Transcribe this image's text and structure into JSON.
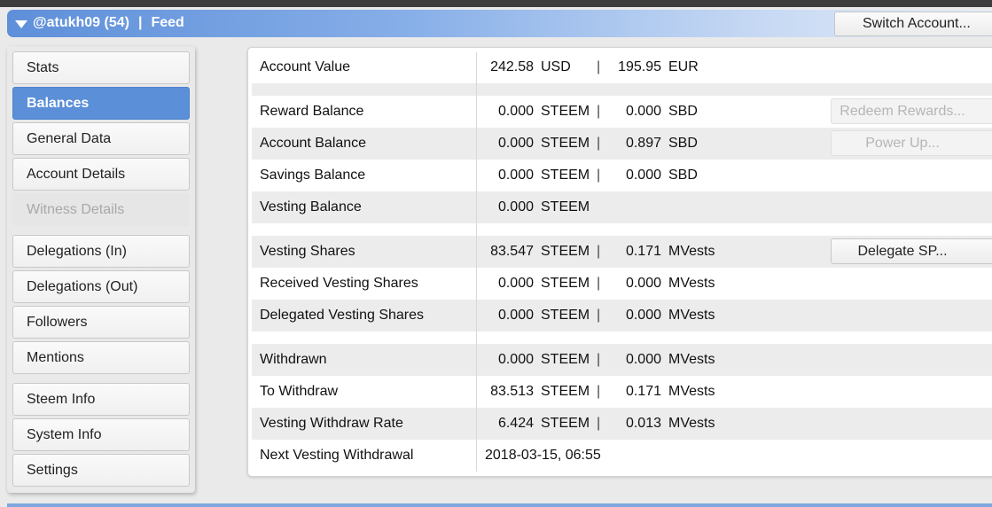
{
  "header": {
    "account": "@atukh09 (54)",
    "separator": "|",
    "section": "Feed",
    "switch_label": "Switch Account..."
  },
  "sidebar": {
    "items": [
      {
        "label": "Stats"
      },
      {
        "label": "Balances"
      },
      {
        "label": "General Data"
      },
      {
        "label": "Account Details"
      },
      {
        "label": "Witness Details"
      },
      {
        "label": "Delegations (In)"
      },
      {
        "label": "Delegations (Out)"
      },
      {
        "label": "Followers"
      },
      {
        "label": "Mentions"
      },
      {
        "label": "Steem Info"
      },
      {
        "label": "System Info"
      },
      {
        "label": "Settings"
      }
    ],
    "active": "Balances",
    "disabled": "Witness Details"
  },
  "balances": {
    "rows": [
      {
        "label": "Account Value",
        "v1": "242.58",
        "u1": "USD",
        "sep": "|",
        "v2": "195.95",
        "u2": "EUR"
      },
      {
        "label": "Reward Balance",
        "v1": "0.000",
        "u1": "STEEM",
        "sep": "|",
        "v2": "0.000",
        "u2": "SBD",
        "button": "Redeem Rewards..."
      },
      {
        "label": "Account Balance",
        "v1": "0.000",
        "u1": "STEEM",
        "sep": "|",
        "v2": "0.897",
        "u2": "SBD",
        "button": "Power Up..."
      },
      {
        "label": "Savings Balance",
        "v1": "0.000",
        "u1": "STEEM",
        "sep": "|",
        "v2": "0.000",
        "u2": "SBD"
      },
      {
        "label": "Vesting Balance",
        "v1": "0.000",
        "u1": "STEEM"
      },
      {
        "label": "Vesting Shares",
        "v1": "83.547",
        "u1": "STEEM",
        "sep": "|",
        "v2": "0.171",
        "u2": "MVests",
        "button": "Delegate SP..."
      },
      {
        "label": "Received Vesting Shares",
        "v1": "0.000",
        "u1": "STEEM",
        "sep": "|",
        "v2": "0.000",
        "u2": "MVests"
      },
      {
        "label": "Delegated Vesting Shares",
        "v1": "0.000",
        "u1": "STEEM",
        "sep": "|",
        "v2": "0.000",
        "u2": "MVests"
      },
      {
        "label": "Withdrawn",
        "v1": "0.000",
        "u1": "STEEM",
        "sep": "|",
        "v2": "0.000",
        "u2": "MVests"
      },
      {
        "label": "To Withdraw",
        "v1": "83.513",
        "u1": "STEEM",
        "sep": "|",
        "v2": "0.171",
        "u2": "MVests"
      },
      {
        "label": "Vesting Withdraw Rate",
        "v1": "6.424",
        "u1": "STEEM",
        "sep": "|",
        "v2": "0.013",
        "u2": "MVests"
      },
      {
        "label": "Next Vesting Withdrawal",
        "full": "2018-03-15, 06:55"
      }
    ]
  },
  "colors": {
    "accent": "#5b8fd8",
    "title_gradient_start": "#5e8fd9",
    "row_shade": "#ececec"
  }
}
